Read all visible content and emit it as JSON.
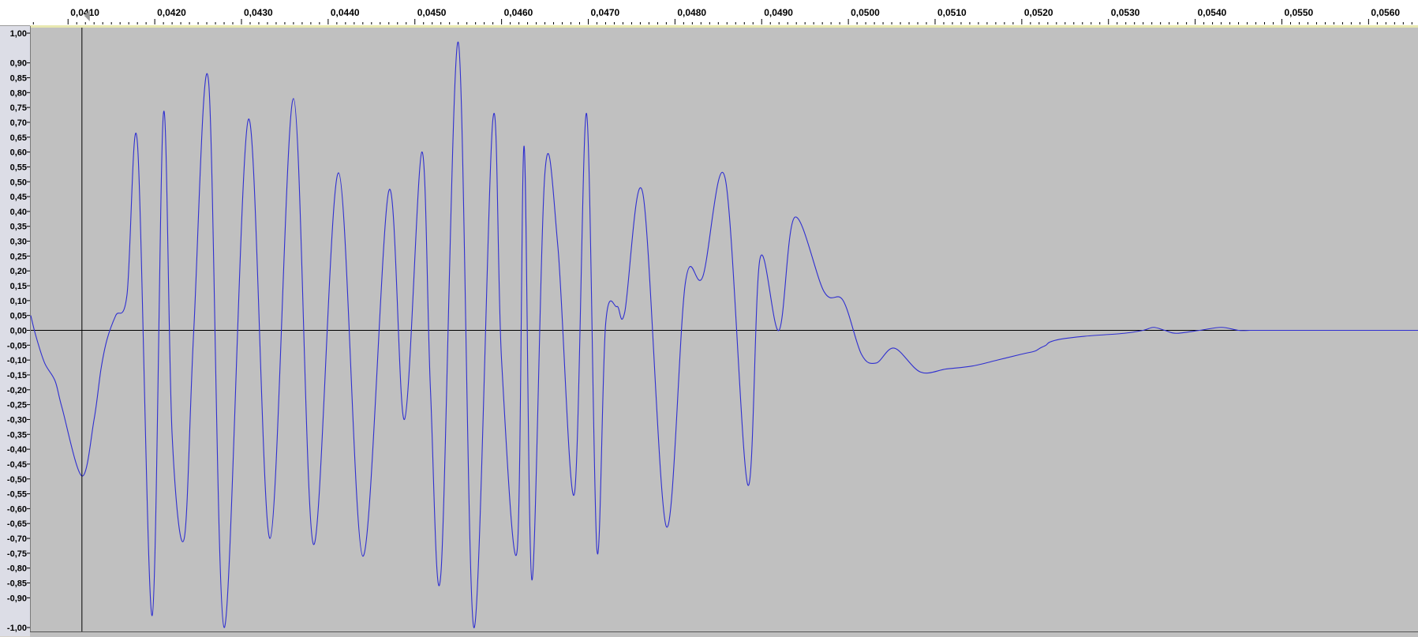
{
  "colors": {
    "track_background": "#c0c0c0",
    "waveform": "#2f2fd0",
    "zero_line": "#000000",
    "cursor": "#000000"
  },
  "chart_data": {
    "type": "line",
    "title": "",
    "xlabel": "",
    "ylabel": "",
    "xlim": [
      0.04057,
      0.05657
    ],
    "ylim": [
      -1.0,
      1.0
    ],
    "x_ticks": [
      "0,0410",
      "0,0420",
      "0,0430",
      "0,0440",
      "0,0450",
      "0,0460",
      "0,0470",
      "0,0480",
      "0,0490",
      "0,0500",
      "0,0510",
      "0,0520",
      "0,0530",
      "0,0540",
      "0,0550",
      "0,0560"
    ],
    "x_tick_values": [
      0.041,
      0.042,
      0.043,
      0.044,
      0.045,
      0.046,
      0.047,
      0.048,
      0.049,
      0.05,
      0.051,
      0.052,
      0.053,
      0.054,
      0.055,
      0.056
    ],
    "y_ticks": [
      "1,00",
      "0,90",
      "0,85",
      "0,80",
      "0,75",
      "0,70",
      "0,65",
      "0,60",
      "0,55",
      "0,50",
      "0,45",
      "0,40",
      "0,35",
      "0,30",
      "0,25",
      "0,20",
      "0,15",
      "0,10",
      "0,05",
      "0,00",
      "-0,05",
      "-0,10",
      "-0,15",
      "-0,20",
      "-0,25",
      "-0,30",
      "-0,35",
      "-0,40",
      "-0,45",
      "-0,50",
      "-0,55",
      "-0,60",
      "-0,65",
      "-0,70",
      "-0,75",
      "-0,80",
      "-0,85",
      "-0,90",
      "-1,00"
    ],
    "y_tick_values": [
      1.0,
      0.9,
      0.85,
      0.8,
      0.75,
      0.7,
      0.65,
      0.6,
      0.55,
      0.5,
      0.45,
      0.4,
      0.35,
      0.3,
      0.25,
      0.2,
      0.15,
      0.1,
      0.05,
      0.0,
      -0.05,
      -0.1,
      -0.15,
      -0.2,
      -0.25,
      -0.3,
      -0.35,
      -0.4,
      -0.45,
      -0.5,
      -0.55,
      -0.6,
      -0.65,
      -0.7,
      -0.75,
      -0.8,
      -0.85,
      -0.9,
      -1.0
    ],
    "cursor_time": 0.04116,
    "grid": false,
    "legend": "none",
    "series": [
      {
        "x": [
          0.04057,
          0.04063,
          0.04073,
          0.04085,
          0.04093,
          0.04116,
          0.0413,
          0.04138,
          0.04145,
          0.04155,
          0.04168,
          0.0418,
          0.04197,
          0.0421,
          0.0422,
          0.04234,
          0.04245,
          0.04262,
          0.0428,
          0.04308,
          0.04333,
          0.0436,
          0.04383,
          0.04412,
          0.0444,
          0.0447,
          0.04488,
          0.04508,
          0.04518,
          0.0453,
          0.0455,
          0.04568,
          0.0459,
          0.046,
          0.04618,
          0.04626,
          0.04635,
          0.0465,
          0.04665,
          0.04684,
          0.04698,
          0.0471,
          0.0472,
          0.04733,
          0.04742,
          0.04763,
          0.0479,
          0.04812,
          0.04832,
          0.04858,
          0.04884,
          0.04898,
          0.0492,
          0.04938,
          0.04972,
          0.04994,
          0.05015,
          0.05032,
          0.05053,
          0.05083,
          0.05113,
          0.05143,
          0.05172,
          0.052,
          0.05215,
          0.05221,
          0.05228,
          0.05232,
          0.05244,
          0.05272,
          0.05318,
          0.0534,
          0.05352,
          0.05365,
          0.05378,
          0.05405,
          0.0543,
          0.0545,
          0.05463,
          0.0548,
          0.055,
          0.0552,
          0.05536,
          0.05555,
          0.05579,
          0.05589,
          0.056,
          0.0561,
          0.0563,
          0.0564,
          0.05657
        ],
        "y": [
          0.05,
          -0.02,
          -0.11,
          -0.17,
          -0.26,
          -0.49,
          -0.3,
          -0.13,
          -0.03,
          0.05,
          0.12,
          0.63,
          -0.96,
          0.73,
          -0.35,
          -0.7,
          0.0,
          0.84,
          -1.0,
          0.71,
          -0.7,
          0.78,
          -0.72,
          0.53,
          -0.76,
          0.47,
          -0.3,
          0.6,
          -0.2,
          -0.82,
          0.97,
          -1.0,
          0.71,
          -0.1,
          -0.74,
          0.62,
          -0.84,
          0.53,
          0.28,
          -0.55,
          0.73,
          -0.74,
          0.02,
          0.08,
          0.06,
          0.46,
          -0.66,
          0.16,
          0.18,
          0.51,
          -0.52,
          0.24,
          0.0,
          0.38,
          0.13,
          0.1,
          -0.08,
          -0.11,
          -0.06,
          -0.14,
          -0.13,
          -0.12,
          -0.1,
          -0.08,
          -0.07,
          -0.06,
          -0.05,
          -0.04,
          -0.03,
          -0.02,
          -0.01,
          0.0,
          0.01,
          0.0,
          -0.01,
          0.0,
          0.01,
          0.0,
          0.0,
          0.0,
          0.0,
          0.0,
          0.0,
          0.0,
          0.0,
          0.0,
          0.0,
          0.0,
          0.0,
          0.0,
          0.0
        ]
      }
    ]
  }
}
